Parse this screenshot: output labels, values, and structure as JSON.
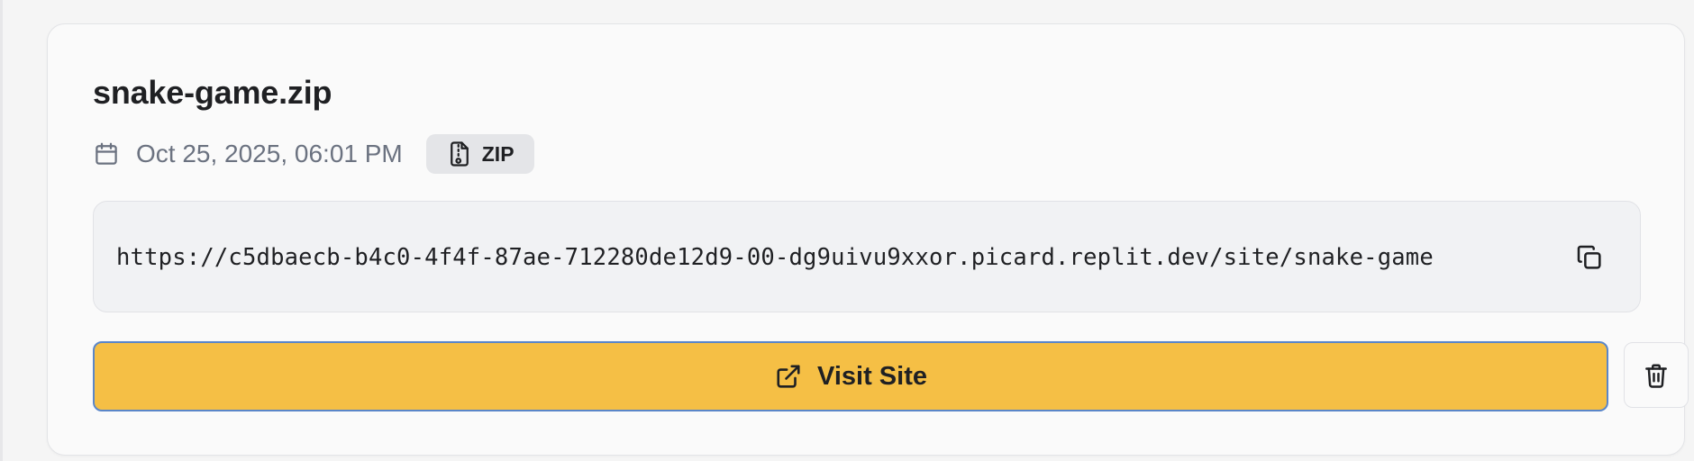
{
  "file": {
    "name": "snake-game.zip",
    "date": "Oct 25, 2025, 06:01 PM",
    "type_badge": "ZIP",
    "url": "https://c5dbaecb-b4c0-4f4f-87ae-712280de12d9-00-dg9uivu9xxor.picard.replit.dev/site/snake-game"
  },
  "actions": {
    "visit_label": "Visit Site"
  },
  "icons": {
    "date": "calendar-icon",
    "type": "file-archive-icon",
    "copy": "copy-icon",
    "visit": "external-link-icon",
    "delete": "trash-icon"
  },
  "colors": {
    "accent": "#f5bf45",
    "focus_ring": "#5a86c9",
    "muted_text": "#6b7280",
    "badge_bg": "#e4e5e8"
  }
}
